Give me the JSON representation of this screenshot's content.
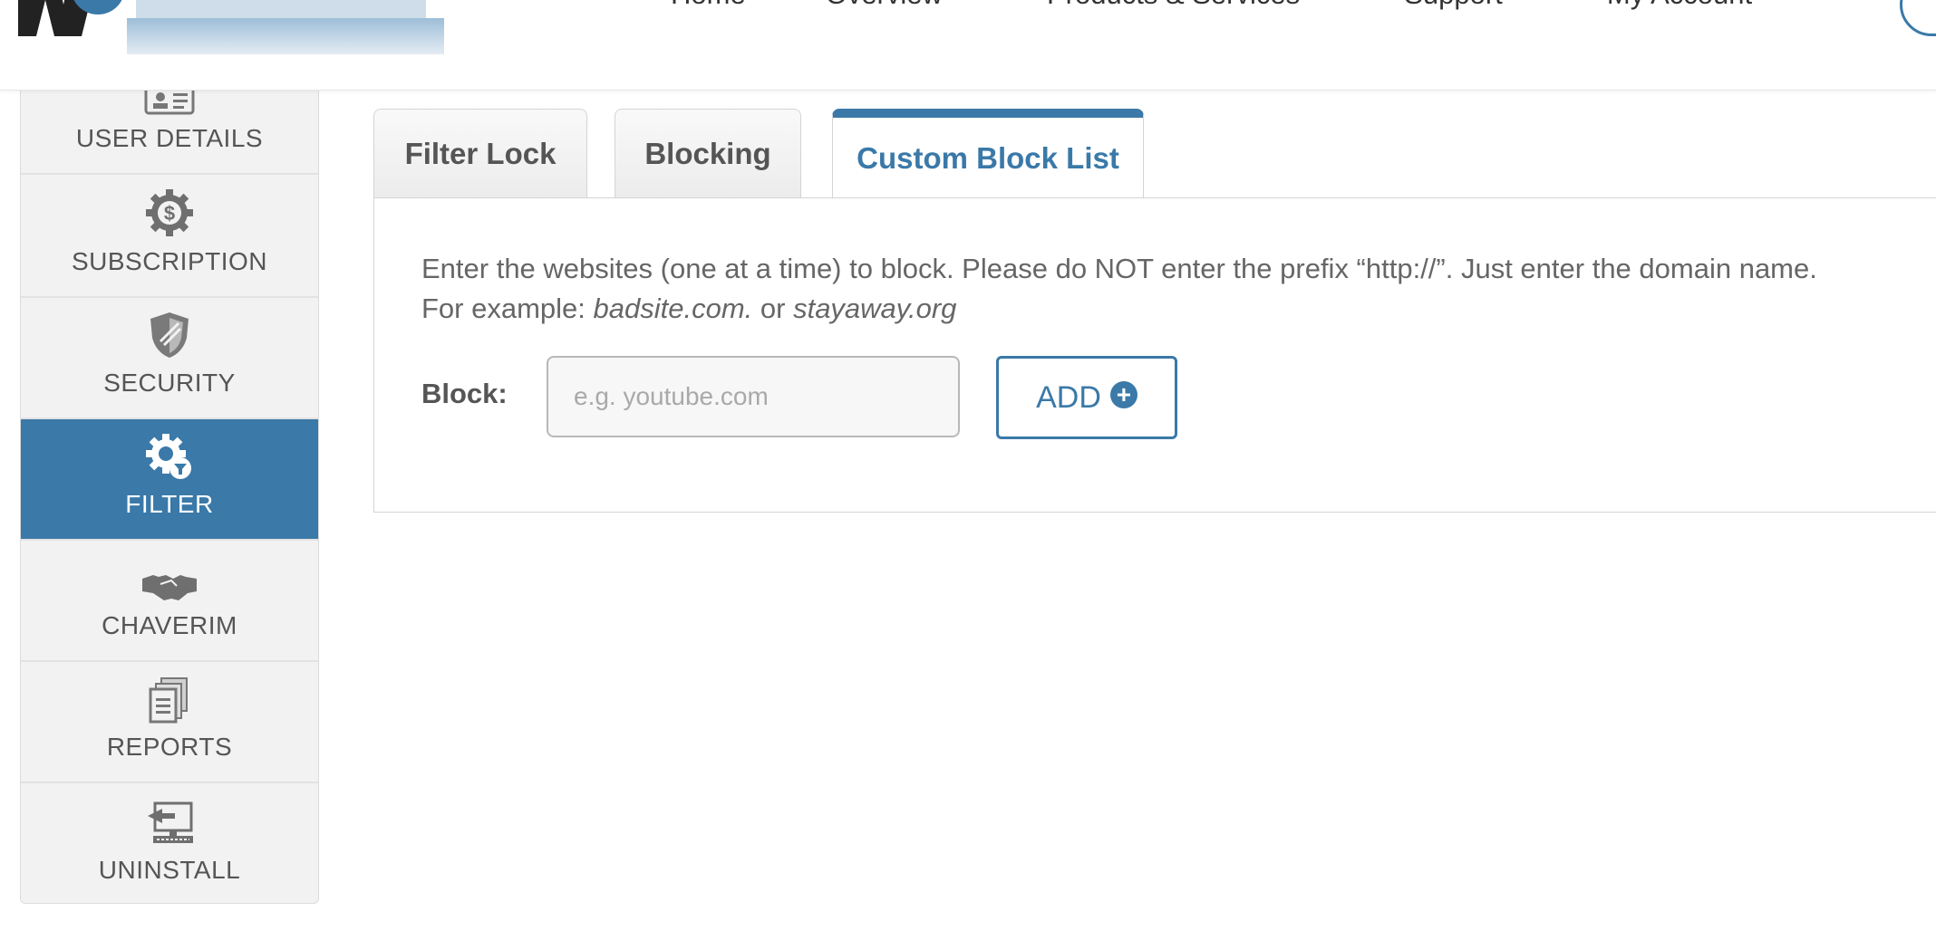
{
  "header": {
    "nav": [
      {
        "label": "Home",
        "has_dropdown": false
      },
      {
        "label": "Overview",
        "has_dropdown": true
      },
      {
        "label": "Products & Services",
        "has_dropdown": true
      },
      {
        "label": "Support",
        "has_dropdown": true
      },
      {
        "label": "My Account",
        "has_dropdown": true
      }
    ]
  },
  "sidebar": {
    "items": [
      {
        "label": "USER DETAILS",
        "icon": "id-card-icon",
        "active": false
      },
      {
        "label": "SUBSCRIPTION",
        "icon": "dollar-gear-icon",
        "active": false
      },
      {
        "label": "SECURITY",
        "icon": "shield-icon",
        "active": false
      },
      {
        "label": "FILTER",
        "icon": "filter-gear-icon",
        "active": true
      },
      {
        "label": "CHAVERIM",
        "icon": "handshake-icon",
        "active": false
      },
      {
        "label": "REPORTS",
        "icon": "documents-icon",
        "active": false
      },
      {
        "label": "UNINSTALL",
        "icon": "computer-exit-icon",
        "active": false
      }
    ]
  },
  "tabs": [
    {
      "label": "Filter Lock",
      "active": false
    },
    {
      "label": "Blocking",
      "active": false
    },
    {
      "label": "Custom Block List",
      "active": true
    }
  ],
  "panel": {
    "instruction": "Enter the websites (one at a time) to block. Please do NOT enter the prefix “http://”. Just enter the domain name.",
    "example_prefix": "For example: ",
    "example_1": "badsite.com.",
    "example_joiner": " or ",
    "example_2": "stayaway.org",
    "block_label": "Block:",
    "block_placeholder": "e.g. youtube.com",
    "block_value": "",
    "add_label": "ADD"
  },
  "colors": {
    "accent": "#3a79a8",
    "sidebar_bg": "#f2f2f2",
    "text": "#555555"
  }
}
